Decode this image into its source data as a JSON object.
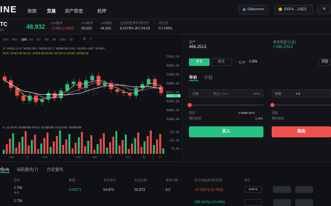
{
  "header": {
    "logo": "INE",
    "nav": [
      "数据",
      "交易",
      "资产管理",
      "抵押"
    ],
    "network": "Ethereum",
    "wallet": "0XF4....10E3"
  },
  "ticker": {
    "symbol": "TC",
    "price": "48,932",
    "sub": "ple",
    "stats": [
      {
        "label": "24h最高",
        "value": "-2.28% (-2250)",
        "color": "#f0504d"
      },
      {
        "label": "24h最高",
        "value": "50,932"
      },
      {
        "label": "24h最低",
        "value": "44,932"
      },
      {
        "label": "当前资金费率/倒计时",
        "value": "8.1673%  2h7:24:29"
      },
      {
        "label": "持仓量",
        "value": "0.1700%"
      }
    ]
  },
  "chart": {
    "timeframes": [
      "15m",
      "30m",
      "1H",
      "4H",
      "1D",
      "1W",
      "1M",
      "12M",
      "1D"
    ],
    "info1": "O: 44932.12  H: 54063.99  L: 54053.32  C: 46056.08  CHG: +6.08%  AMP: 16.59%",
    "info2": "MA5: 44063.99  MA10: 44063.99  MA30: 53753.12  MA60: 54056.08",
    "yaxis": [
      "53963.99",
      "60000.00",
      "55000.00",
      "50000.00",
      "46032.00",
      "45000.00",
      "40000.00",
      "35000.00"
    ],
    "last_price": "46032.00",
    "vol_info": "5, 10)  MA5: 83489389  MA12: 83489389  VOLUME: 83489389",
    "xaxis": [
      "Nov",
      "17",
      "Dec",
      "3",
      "2017",
      "Mar",
      "17",
      "Dec",
      "Jul",
      "17"
    ],
    "vol_y": [
      "250.00",
      "100.00",
      "50.00"
    ]
  },
  "chart_data": {
    "type": "line",
    "series": [
      {
        "values": [
          52000,
          49000,
          46000,
          44000,
          46000,
          43500,
          44500,
          47000,
          45000,
          48000,
          50500,
          51500,
          49000,
          52000,
          53800,
          50000,
          51000,
          48500,
          47500,
          47000,
          46000,
          49000,
          50500,
          52500,
          49500,
          47000
        ]
      }
    ],
    "yaxis_ticks": [
      60000,
      55000,
      50000,
      45000,
      40000,
      35000
    ]
  },
  "trade": {
    "asset_label": "资产",
    "asset_value": "466.2513",
    "pnl_label": "未实现盈亏(总)",
    "pnl_value": "+166.2513",
    "tabs": [
      "全仓",
      "逐仓"
    ],
    "leverage_label": "杠杆",
    "leverage_value": "1.00x",
    "adjust": "调整",
    "order_tabs": [
      "市价",
      "计划"
    ],
    "price_label": "价格",
    "price_ph": "最佳 1,027",
    "unit": "BTC",
    "qty_label": "数量",
    "qty_value": "0.8",
    "avail_label": "可买",
    "avail_value": "0.8989 BTC",
    "margin_label": "预计杠杆",
    "margin_value": "1.00x",
    "avail2_label": "可卖",
    "avail2_value": "0.8989 BTC",
    "margin2_label": "预计杠杆",
    "margin2_value": "1.00x",
    "buy": "买入",
    "sell": "卖出"
  },
  "bottom": {
    "tabs": [
      "仓(4)",
      "当前委托(7)",
      "历史委托"
    ],
    "headers": [
      "杠杆",
      "数量",
      "开仓均价",
      "标记价格",
      "强平价格",
      "盈亏/收益率(未实现)",
      "平仓"
    ],
    "rows": [
      {
        "lev": "1.79x",
        "side": "多仓",
        "qty": "0.00271",
        "open": "54,873",
        "mark": "52,873",
        "liq": "4,2",
        "pnl": "-27.0317(-12.76%)",
        "close": "52873"
      },
      {
        "lev": "1.79x",
        "side": "",
        "qty": "",
        "open": "",
        "mark": "",
        "liq": "",
        "pnl": "289.0475(+12.04%)",
        "close": ""
      }
    ]
  },
  "colors": {
    "up": "#26c281",
    "down": "#f0504d",
    "bg": "#0f1013"
  }
}
